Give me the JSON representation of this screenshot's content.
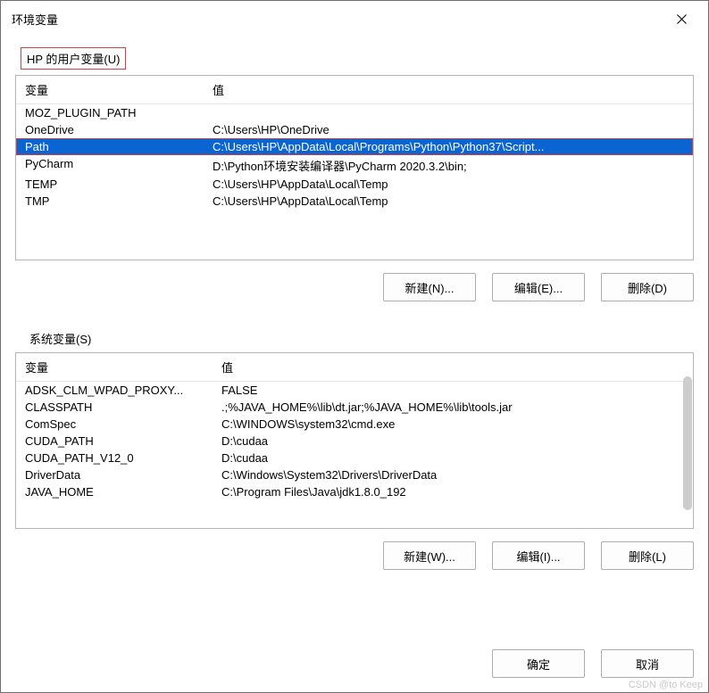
{
  "title": "环境变量",
  "userGroup": {
    "label": "HP 的用户变量(U)",
    "columns": {
      "var": "变量",
      "val": "值"
    },
    "rows": [
      {
        "var": "MOZ_PLUGIN_PATH",
        "val": "",
        "selected": false
      },
      {
        "var": "OneDrive",
        "val": "C:\\Users\\HP\\OneDrive",
        "selected": false
      },
      {
        "var": "Path",
        "val": "C:\\Users\\HP\\AppData\\Local\\Programs\\Python\\Python37\\Script...",
        "selected": true
      },
      {
        "var": "PyCharm",
        "val": "D:\\Python环境安装编译器\\PyCharm 2020.3.2\\bin;",
        "selected": false
      },
      {
        "var": "TEMP",
        "val": "C:\\Users\\HP\\AppData\\Local\\Temp",
        "selected": false
      },
      {
        "var": "TMP",
        "val": "C:\\Users\\HP\\AppData\\Local\\Temp",
        "selected": false
      }
    ],
    "buttons": {
      "new": "新建(N)...",
      "edit": "编辑(E)...",
      "del": "删除(D)"
    }
  },
  "sysGroup": {
    "label": "系统变量(S)",
    "columns": {
      "var": "变量",
      "val": "值"
    },
    "rows": [
      {
        "var": "ADSK_CLM_WPAD_PROXY...",
        "val": "FALSE"
      },
      {
        "var": "CLASSPATH",
        "val": ".;%JAVA_HOME%\\lib\\dt.jar;%JAVA_HOME%\\lib\\tools.jar"
      },
      {
        "var": "ComSpec",
        "val": "C:\\WINDOWS\\system32\\cmd.exe"
      },
      {
        "var": "CUDA_PATH",
        "val": "D:\\cudaa"
      },
      {
        "var": "CUDA_PATH_V12_0",
        "val": "D:\\cudaa"
      },
      {
        "var": "DriverData",
        "val": "C:\\Windows\\System32\\Drivers\\DriverData"
      },
      {
        "var": "JAVA_HOME",
        "val": "C:\\Program Files\\Java\\jdk1.8.0_192"
      }
    ],
    "buttons": {
      "new": "新建(W)...",
      "edit": "编辑(I)...",
      "del": "删除(L)"
    }
  },
  "footer": {
    "ok": "确定",
    "cancel": "取消"
  },
  "watermark": "CSDN @to Keep"
}
